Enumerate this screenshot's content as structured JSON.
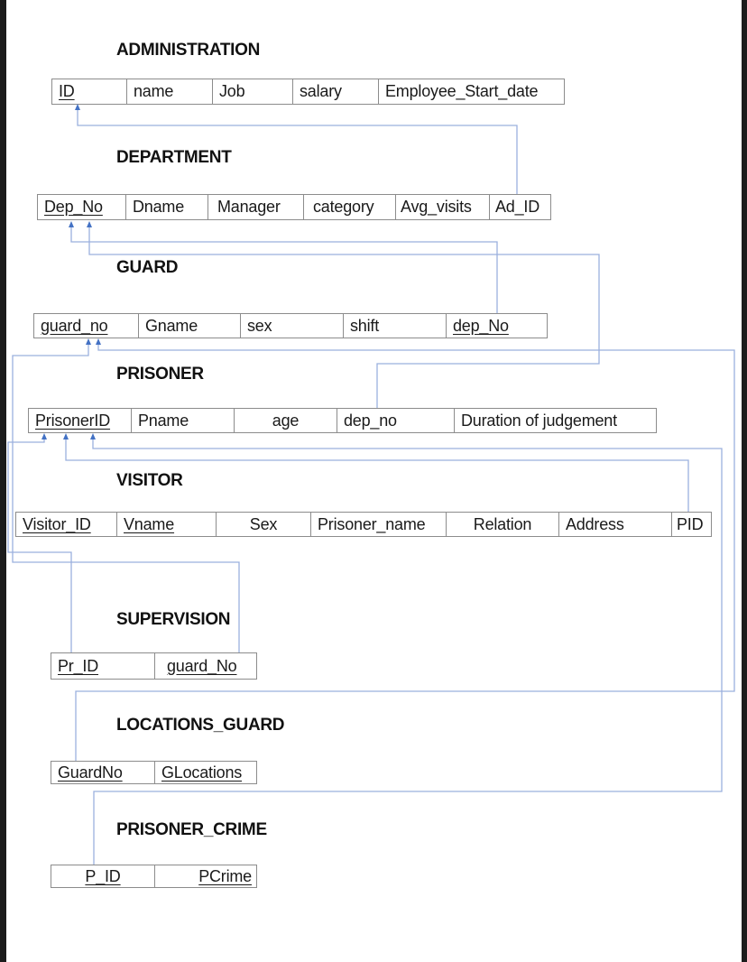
{
  "colors": {
    "connector": "#9bb0de",
    "arrow": "#4472c4",
    "cell_border": "#8c8c8c",
    "text": "#1a1a1a",
    "page": "#ffffff",
    "frame": "#1c1c1c"
  },
  "tables": [
    {
      "name": "ADMINISTRATION",
      "columns": [
        {
          "label": "ID",
          "key": true
        },
        {
          "label": "name",
          "key": false
        },
        {
          "label": "Job",
          "key": false
        },
        {
          "label": "salary",
          "key": false
        },
        {
          "label": "Employee_Start_date",
          "key": false
        }
      ]
    },
    {
      "name": "DEPARTMENT",
      "columns": [
        {
          "label": "Dep_No",
          "key": true
        },
        {
          "label": "Dname",
          "key": false
        },
        {
          "label": "Manager",
          "key": false
        },
        {
          "label": "category",
          "key": false
        },
        {
          "label": "Avg_visits",
          "key": false
        },
        {
          "label": "Ad_ID",
          "key": false
        }
      ]
    },
    {
      "name": "GUARD",
      "columns": [
        {
          "label": "guard_no",
          "key": true
        },
        {
          "label": "Gname",
          "key": false
        },
        {
          "label": "sex",
          "key": false
        },
        {
          "label": "shift",
          "key": false
        },
        {
          "label": "dep_No",
          "key": true
        }
      ]
    },
    {
      "name": "PRISONER",
      "columns": [
        {
          "label": "PrisonerID",
          "key": true
        },
        {
          "label": "Pname",
          "key": false
        },
        {
          "label": "age",
          "key": false
        },
        {
          "label": "dep_no",
          "key": false
        },
        {
          "label": "Duration of judgement",
          "key": false
        }
      ]
    },
    {
      "name": "VISITOR",
      "columns": [
        {
          "label": "Visitor_ID",
          "key": true
        },
        {
          "label": "Vname",
          "key": true
        },
        {
          "label": "Sex",
          "key": false
        },
        {
          "label": "Prisoner_name",
          "key": false
        },
        {
          "label": "Relation",
          "key": false
        },
        {
          "label": "Address",
          "key": false
        },
        {
          "label": "PID",
          "key": false
        }
      ]
    },
    {
      "name": "SUPERVISION",
      "columns": [
        {
          "label": "Pr_ID",
          "key": true
        },
        {
          "label": "guard_No",
          "key": true
        }
      ]
    },
    {
      "name": "LOCATIONS_GUARD",
      "columns": [
        {
          "label": "GuardNo",
          "key": true
        },
        {
          "label": "GLocations",
          "key": true
        }
      ]
    },
    {
      "name": "PRISONER_CRIME",
      "columns": [
        {
          "label": "P_ID",
          "key": true
        },
        {
          "label": "PCrime",
          "key": true
        }
      ]
    }
  ],
  "relationships": [
    {
      "from": "DEPARTMENT.Ad_ID",
      "to": "ADMINISTRATION.ID"
    },
    {
      "from": "GUARD.dep_No",
      "to": "DEPARTMENT.Dep_No"
    },
    {
      "from": "PRISONER.dep_no",
      "to": "DEPARTMENT.Dep_No"
    },
    {
      "from": "SUPERVISION.guard_No",
      "to": "GUARD.guard_no"
    },
    {
      "from": "LOCATIONS_GUARD.GuardNo",
      "to": "GUARD.guard_no"
    },
    {
      "from": "SUPERVISION.Pr_ID",
      "to": "PRISONER.PrisonerID"
    },
    {
      "from": "VISITOR.PID",
      "to": "PRISONER.PrisonerID"
    },
    {
      "from": "PRISONER_CRIME.P_ID",
      "to": "PRISONER.PrisonerID"
    }
  ]
}
